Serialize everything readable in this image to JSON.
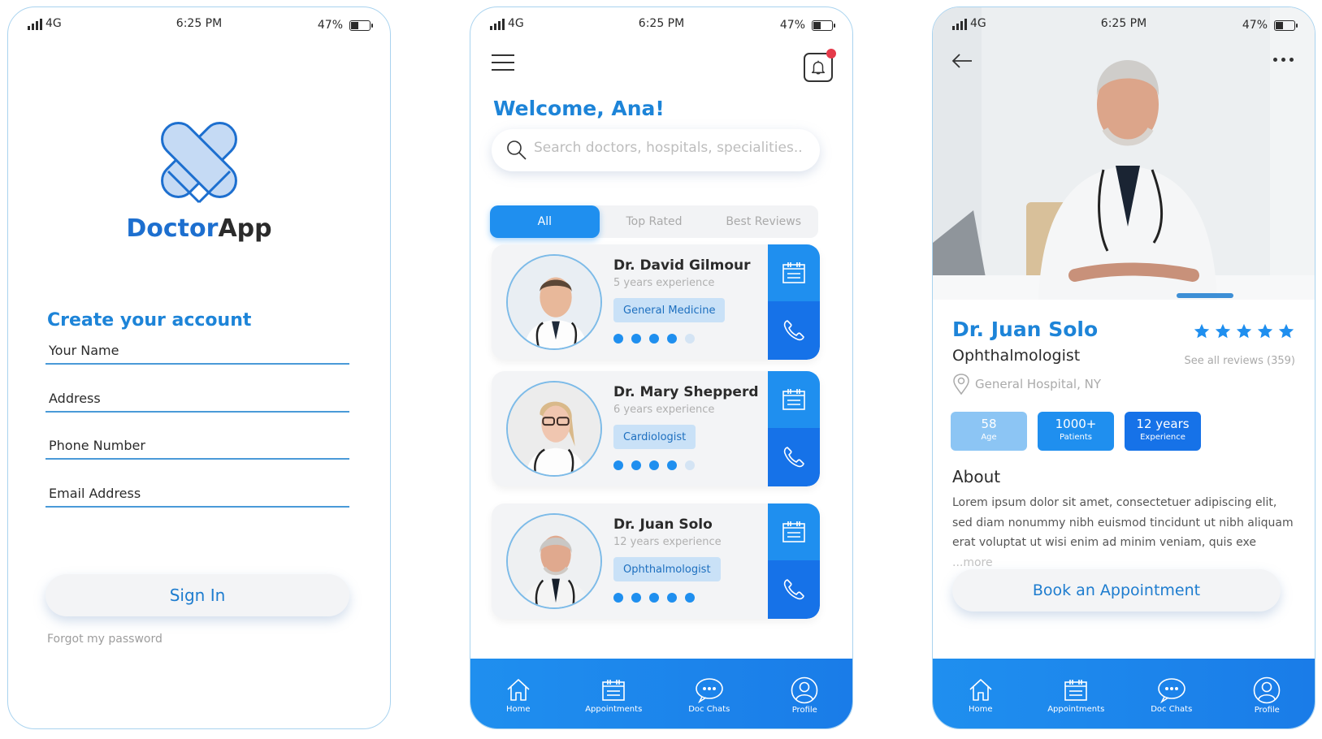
{
  "status_bar": {
    "network": "4G",
    "time": "6:25 PM",
    "battery": "47%"
  },
  "signup": {
    "brand_part1": "Doctor",
    "brand_part2": "App",
    "title": "Create your account",
    "fields": [
      {
        "placeholder": "Your Name",
        "value": ""
      },
      {
        "placeholder": "Address",
        "value": ""
      },
      {
        "placeholder": "Phone Number",
        "value": ""
      },
      {
        "placeholder": "Email Address",
        "value": ""
      }
    ],
    "sign_in_label": "Sign In",
    "forgot_label": "Forgot my password"
  },
  "home": {
    "welcome": "Welcome, Ana!",
    "search_placeholder": "Search doctors, hospitals, specialities...",
    "tabs": [
      {
        "label": "All",
        "active": true
      },
      {
        "label": "Top Rated",
        "active": false
      },
      {
        "label": "Best Reviews",
        "active": false
      }
    ],
    "doctors": [
      {
        "name": "Dr. David Gilmour",
        "experience": "5 years experience",
        "specialty": "General Medicine",
        "rating": 4,
        "rating_max": 5
      },
      {
        "name": "Dr. Mary Shepperd",
        "experience": "6 years experience",
        "specialty": "Cardiologist",
        "rating": 4,
        "rating_max": 5
      },
      {
        "name": "Dr. Juan Solo",
        "experience": "12 years experience",
        "specialty": "Ophthalmologist",
        "rating": 5,
        "rating_max": 5
      }
    ]
  },
  "profile": {
    "name": "Dr. Juan Solo",
    "specialty": "Ophthalmologist",
    "stars": 5,
    "reviews_link": "See all reviews (359)",
    "location": "General Hospital, NY",
    "stats": [
      {
        "value": "58",
        "label": "Age"
      },
      {
        "value": "1000+",
        "label": "Patients"
      },
      {
        "value": "12 years",
        "label": "Experience"
      }
    ],
    "about_title": "About",
    "about_text": "Lorem ipsum dolor sit amet, consectetuer adipiscing elit, sed diam nonummy nibh euismod tincidunt ut nibh aliquam erat voluptat ut wisi enim ad minim veniam, quis exe ",
    "about_more": "...more",
    "book_label": "Book an Appointment"
  },
  "nav": [
    {
      "label": "Home",
      "icon": "home-icon"
    },
    {
      "label": "Appointments",
      "icon": "calendar-icon"
    },
    {
      "label": "Doc Chats",
      "icon": "chat-icon"
    },
    {
      "label": "Profile",
      "icon": "profile-icon"
    }
  ],
  "colors": {
    "primary": "#1f8fef",
    "primary_dark": "#1672e8",
    "brand": "#1d6fcf",
    "notification": "#e53a4a",
    "chip_bg": "#c9e1f7"
  }
}
